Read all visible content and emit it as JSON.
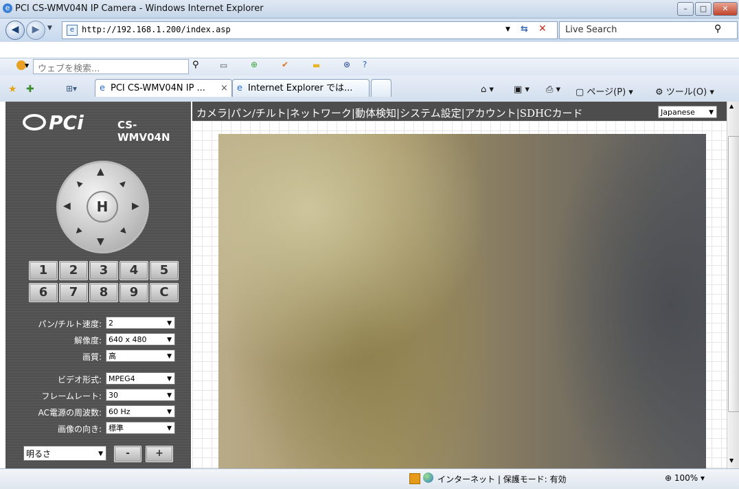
{
  "window": {
    "title": "PCI CS-WMV04N IP Camera - Windows Internet Explorer"
  },
  "address": {
    "url": "http://192.168.1.200/index.asp",
    "search_placeholder": "Live Search"
  },
  "toolbar": {
    "search_placeholder": "ウェブを検索..."
  },
  "tabs": [
    {
      "label": "PCI CS-WMV04N IP ...",
      "active": true
    },
    {
      "label": "Internet Explorer では..."
    }
  ],
  "commands": {
    "page": "ページ(P)",
    "tools": "ツール(O)"
  },
  "camera": {
    "brand": "PCi",
    "model": "CS-WMV04N",
    "ptz_home": "H",
    "presets": [
      "1",
      "2",
      "3",
      "4",
      "5",
      "6",
      "7",
      "8",
      "9",
      "C"
    ],
    "menu": "カメラ|パン/チルト|ネットワーク|動体検知|システム設定|アカウント|SDHCカード",
    "language": "Japanese",
    "settings": [
      {
        "label": "パン/チルト速度:",
        "value": "2"
      },
      {
        "label": "解像度:",
        "value": "640 x 480"
      },
      {
        "label": "画質:",
        "value": "高"
      },
      {
        "label": "ビデオ形式:",
        "value": "MPEG4"
      },
      {
        "label": "フレームレート:",
        "value": "30"
      },
      {
        "label": "AC電源の周波数:",
        "value": "60 Hz"
      },
      {
        "label": "画像の向き:",
        "value": "標準"
      }
    ],
    "adjust": {
      "select": "明るさ",
      "minus": "-",
      "plus": "+"
    }
  },
  "status": {
    "zone": "インターネット | 保護モード: 有効",
    "zoom": "100%"
  }
}
